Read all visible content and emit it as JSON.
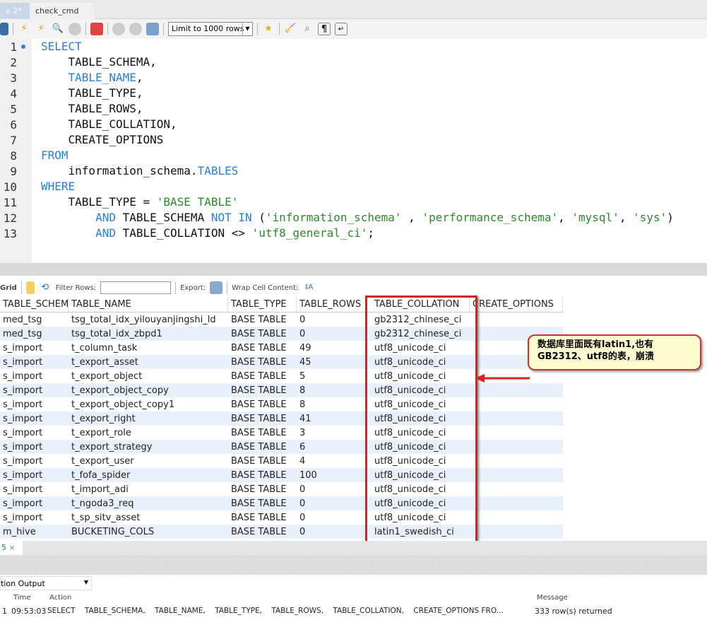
{
  "tabs": [
    {
      "label": "e 2*",
      "close": "×"
    },
    {
      "label": "check_cmd"
    }
  ],
  "toolbar": {
    "limit": "Limit to 1000 rows",
    "icons": [
      "save-icon",
      "execute-icon",
      "execute-current-icon",
      "explain-icon",
      "stop-icon",
      "toggle-error-icon",
      "commit-icon",
      "rollback-icon",
      "autocommit-icon",
      "add-snippet-icon",
      "beautify-icon",
      "find-icon",
      "invisible-chars-icon",
      "wrap-icon"
    ]
  },
  "editor": {
    "lines": [
      [
        {
          "t": "SELECT",
          "k": "kw"
        }
      ],
      [
        {
          "t": "    TABLE_SCHEMA,"
        }
      ],
      [
        {
          "t": "    "
        },
        {
          "t": "TABLE_NAME",
          "k": "kw"
        },
        {
          "t": ","
        }
      ],
      [
        {
          "t": "    TABLE_TYPE,"
        }
      ],
      [
        {
          "t": "    TABLE_ROWS,"
        }
      ],
      [
        {
          "t": "    TABLE_COLLATION,"
        }
      ],
      [
        {
          "t": "    CREATE_OPTIONS"
        }
      ],
      [
        {
          "t": "FROM",
          "k": "kw"
        }
      ],
      [
        {
          "t": "    information_schema."
        },
        {
          "t": "TABLES",
          "k": "kw"
        }
      ],
      [
        {
          "t": "WHERE",
          "k": "kw"
        }
      ],
      [
        {
          "t": "    TABLE_TYPE = "
        },
        {
          "t": "'BASE TABLE'",
          "k": "str"
        }
      ],
      [
        {
          "t": "        "
        },
        {
          "t": "AND",
          "k": "kw"
        },
        {
          "t": " TABLE_SCHEMA "
        },
        {
          "t": "NOT IN",
          "k": "kw"
        },
        {
          "t": " ("
        },
        {
          "t": "'information_schema'",
          "k": "str"
        },
        {
          "t": " , "
        },
        {
          "t": "'performance_schema'",
          "k": "str"
        },
        {
          "t": ", "
        },
        {
          "t": "'mysql'",
          "k": "str"
        },
        {
          "t": ", "
        },
        {
          "t": "'sys'",
          "k": "str"
        },
        {
          "t": ")"
        }
      ],
      [
        {
          "t": "        "
        },
        {
          "t": "AND",
          "k": "kw"
        },
        {
          "t": " TABLE_COLLATION <> "
        },
        {
          "t": "'utf8_general_ci'",
          "k": "str"
        },
        {
          "t": ";"
        }
      ]
    ]
  },
  "results_toolbar": {
    "grid": "Grid",
    "filter_label": "Filter Rows:",
    "filter_value": "",
    "export": "Export:",
    "wrap": "Wrap Cell Content:"
  },
  "grid": {
    "columns": [
      "TABLE_SCHEMA",
      "TABLE_NAME",
      "TABLE_TYPE",
      "TABLE_ROWS",
      "TABLE_COLLATION",
      "CREATE_OPTIONS"
    ],
    "rows": [
      [
        "med_tsg",
        "tsg_total_idx_yilouyanjingshi_ld",
        "BASE TABLE",
        "0",
        "gb2312_chinese_ci",
        ""
      ],
      [
        "med_tsg",
        "tsg_total_idx_zbpd1",
        "BASE TABLE",
        "0",
        "gb2312_chinese_ci",
        ""
      ],
      [
        "s_import",
        "t_column_task",
        "BASE TABLE",
        "49",
        "utf8_unicode_ci",
        ""
      ],
      [
        "s_import",
        "t_export_asset",
        "BASE TABLE",
        "45",
        "utf8_unicode_ci",
        ""
      ],
      [
        "s_import",
        "t_export_object",
        "BASE TABLE",
        "5",
        "utf8_unicode_ci",
        ""
      ],
      [
        "s_import",
        "t_export_object_copy",
        "BASE TABLE",
        "8",
        "utf8_unicode_ci",
        ""
      ],
      [
        "s_import",
        "t_export_object_copy1",
        "BASE TABLE",
        "8",
        "utf8_unicode_ci",
        ""
      ],
      [
        "s_import",
        "t_export_right",
        "BASE TABLE",
        "41",
        "utf8_unicode_ci",
        ""
      ],
      [
        "s_import",
        "t_export_role",
        "BASE TABLE",
        "3",
        "utf8_unicode_ci",
        ""
      ],
      [
        "s_import",
        "t_export_strategy",
        "BASE TABLE",
        "6",
        "utf8_unicode_ci",
        ""
      ],
      [
        "s_import",
        "t_export_user",
        "BASE TABLE",
        "4",
        "utf8_unicode_ci",
        ""
      ],
      [
        "s_import",
        "t_fofa_spider",
        "BASE TABLE",
        "100",
        "utf8_unicode_ci",
        ""
      ],
      [
        "s_import",
        "t_import_adi",
        "BASE TABLE",
        "0",
        "utf8_unicode_ci",
        ""
      ],
      [
        "s_import",
        "t_ngoda3_req",
        "BASE TABLE",
        "0",
        "utf8_unicode_ci",
        ""
      ],
      [
        "s_import",
        "t_sp_sitv_asset",
        "BASE TABLE",
        "0",
        "utf8_unicode_ci",
        ""
      ],
      [
        "m_hive",
        "BUCKETING_COLS",
        "BASE TABLE",
        "0",
        "latin1_swedish_ci",
        ""
      ]
    ]
  },
  "annotation": {
    "text": "数据库里面既有latin1,也有GB2312、utf8的表，崩溃",
    "color": "#e02020"
  },
  "bottom_tab": {
    "label": "5",
    "close": "×"
  },
  "output": {
    "selector": "tion Output",
    "headers": [
      "Time",
      "Action",
      "Message"
    ],
    "rows": [
      {
        "n": "1",
        "time": "09:53:03",
        "action": "SELECT    TABLE_SCHEMA,    TABLE_NAME,    TABLE_TYPE,    TABLE_ROWS,    TABLE_COLLATION,    CREATE_OPTIONS FRO...",
        "message": "333 row(s) returned"
      }
    ]
  }
}
